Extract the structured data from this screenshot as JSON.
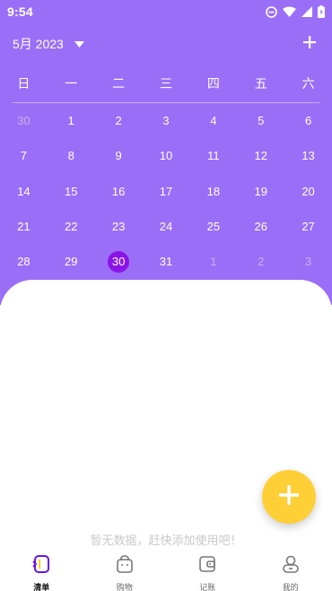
{
  "status_bar": {
    "time": "9:54",
    "icons": [
      "do-not-disturb-icon",
      "wifi-icon",
      "signal-icon",
      "battery-icon"
    ]
  },
  "header": {
    "month_label": "5月 2023",
    "dropdown_icon": "caret-down-icon",
    "add_icon": "plus-icon"
  },
  "calendar": {
    "weekdays": [
      "日",
      "一",
      "二",
      "三",
      "四",
      "五",
      "六"
    ],
    "weeks": [
      [
        {
          "d": "30",
          "m": true
        },
        {
          "d": "1"
        },
        {
          "d": "2"
        },
        {
          "d": "3"
        },
        {
          "d": "4"
        },
        {
          "d": "5"
        },
        {
          "d": "6"
        }
      ],
      [
        {
          "d": "7"
        },
        {
          "d": "8"
        },
        {
          "d": "9"
        },
        {
          "d": "10"
        },
        {
          "d": "11"
        },
        {
          "d": "12"
        },
        {
          "d": "13"
        }
      ],
      [
        {
          "d": "14"
        },
        {
          "d": "15"
        },
        {
          "d": "16"
        },
        {
          "d": "17"
        },
        {
          "d": "18"
        },
        {
          "d": "19"
        },
        {
          "d": "20"
        }
      ],
      [
        {
          "d": "21"
        },
        {
          "d": "22"
        },
        {
          "d": "23"
        },
        {
          "d": "24"
        },
        {
          "d": "25"
        },
        {
          "d": "26"
        },
        {
          "d": "27"
        }
      ],
      [
        {
          "d": "28"
        },
        {
          "d": "29"
        },
        {
          "d": "30",
          "s": true
        },
        {
          "d": "31"
        },
        {
          "d": "1",
          "m": true
        },
        {
          "d": "2",
          "m": true
        },
        {
          "d": "3",
          "m": true
        }
      ]
    ],
    "selected_day": "30"
  },
  "empty_state": {
    "text": "暂无数据，赶快添加使用吧！"
  },
  "fab": {
    "icon": "plus-icon"
  },
  "tabs": [
    {
      "label": "清单",
      "icon": "list-tab-icon",
      "active": true
    },
    {
      "label": "购物",
      "icon": "shopping-bag-icon",
      "active": false
    },
    {
      "label": "记账",
      "icon": "wallet-icon",
      "active": false
    },
    {
      "label": "我的",
      "icon": "profile-icon",
      "active": false
    }
  ],
  "colors": {
    "header_bg": "#9b6ef7",
    "selected_day": "#8a14e8",
    "fab": "#ffcf37",
    "active_tab_icon": "#6a14e0"
  }
}
